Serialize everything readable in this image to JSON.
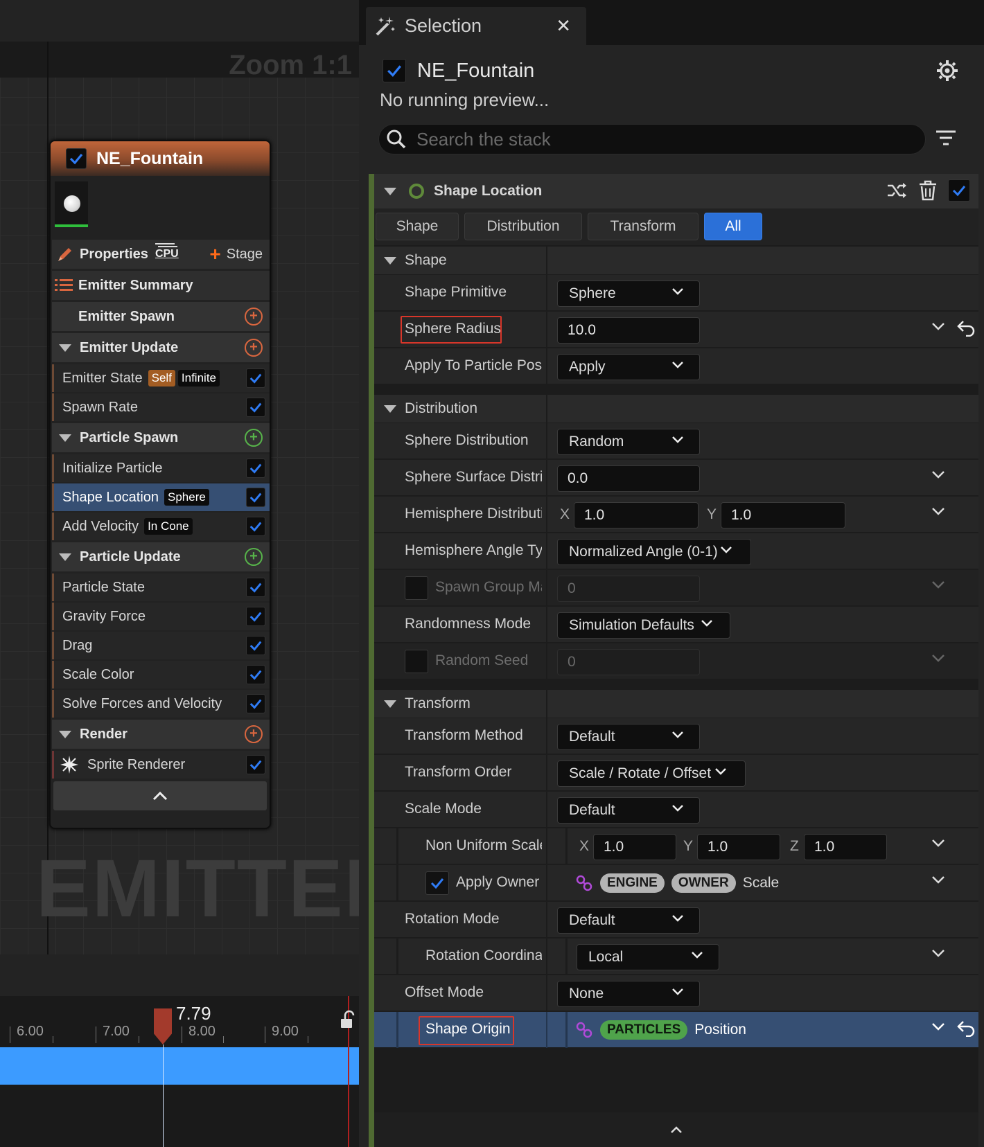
{
  "graph": {
    "zoom_label": "Zoom 1:1",
    "watermark": "EMITTER",
    "node": {
      "title": "NE_Fountain",
      "properties_label": "Properties",
      "cpu_label": "CPU",
      "stage_label": "Stage",
      "emitter_summary": "Emitter Summary",
      "emitter_spawn": "Emitter Spawn",
      "emitter_update": "Emitter Update",
      "emitter_state": "Emitter State",
      "emitter_state_tag1": "Self",
      "emitter_state_tag2": "Infinite",
      "spawn_rate": "Spawn Rate",
      "particle_spawn": "Particle Spawn",
      "initialize_particle": "Initialize Particle",
      "shape_location": "Shape Location",
      "shape_location_tag": "Sphere",
      "add_velocity": "Add Velocity",
      "add_velocity_tag": "In Cone",
      "particle_update": "Particle Update",
      "particle_state": "Particle State",
      "gravity_force": "Gravity Force",
      "drag": "Drag",
      "scale_color": "Scale Color",
      "solve_forces": "Solve Forces and Velocity",
      "render": "Render",
      "sprite_renderer": "Sprite Renderer"
    }
  },
  "timeline": {
    "current_time": "7.79",
    "ticks": [
      "6.00",
      "7.00",
      "8.00",
      "9.00"
    ]
  },
  "panel": {
    "tab_title": "Selection",
    "object_name": "NE_Fountain",
    "preview_status": "No running preview...",
    "search_placeholder": "Search the stack",
    "module_title": "Shape Location",
    "filter_tabs": [
      "Shape",
      "Distribution",
      "Transform",
      "All"
    ],
    "active_filter": "All",
    "sections": {
      "shape": "Shape",
      "distribution": "Distribution",
      "transform": "Transform"
    },
    "rows": {
      "shape_primitive": {
        "label": "Shape Primitive",
        "value": "Sphere"
      },
      "sphere_radius": {
        "label": "Sphere Radius",
        "value": "10.0"
      },
      "apply_to_particle": {
        "label": "Apply To Particle Position",
        "value": "Apply"
      },
      "sphere_distribution": {
        "label": "Sphere Distribution",
        "value": "Random"
      },
      "sphere_surface": {
        "label": "Sphere Surface Distribution",
        "value": "0.0"
      },
      "hemisphere_distribution": {
        "label": "Hemisphere Distribution",
        "x": "1.0",
        "y": "1.0"
      },
      "hemisphere_angle": {
        "label": "Hemisphere Angle Type",
        "value": "Normalized Angle (0-1)"
      },
      "spawn_group": {
        "label": "Spawn Group Mask",
        "value": "0"
      },
      "randomness_mode": {
        "label": "Randomness Mode",
        "value": "Simulation Defaults"
      },
      "random_seed": {
        "label": "Random Seed",
        "value": "0"
      },
      "transform_method": {
        "label": "Transform Method",
        "value": "Default"
      },
      "transform_order": {
        "label": "Transform Order",
        "value": "Scale / Rotate / Offset"
      },
      "scale_mode": {
        "label": "Scale Mode",
        "value": "Default"
      },
      "non_uniform_scale": {
        "label": "Non Uniform Scale",
        "x": "1.0",
        "y": "1.0",
        "z": "1.0"
      },
      "apply_owner_scale": {
        "label": "Apply Owner Scale",
        "pill1": "ENGINE",
        "pill2": "OWNER",
        "suffix": "Scale"
      },
      "rotation_mode": {
        "label": "Rotation Mode",
        "value": "Default"
      },
      "rotation_coordinate": {
        "label": "Rotation Coordinate Space",
        "value": "Local"
      },
      "offset_mode": {
        "label": "Offset Mode",
        "value": "None"
      },
      "shape_origin": {
        "label": "Shape Origin",
        "pill": "PARTICLES",
        "suffix": "Position"
      }
    },
    "axis": {
      "x": "X",
      "y": "Y",
      "z": "Z"
    }
  },
  "colors": {
    "accent_blue": "#2b70d8",
    "highlight_red": "#d8362a",
    "node_orange": "#c0663a",
    "stack_green": "#4f6a32"
  }
}
